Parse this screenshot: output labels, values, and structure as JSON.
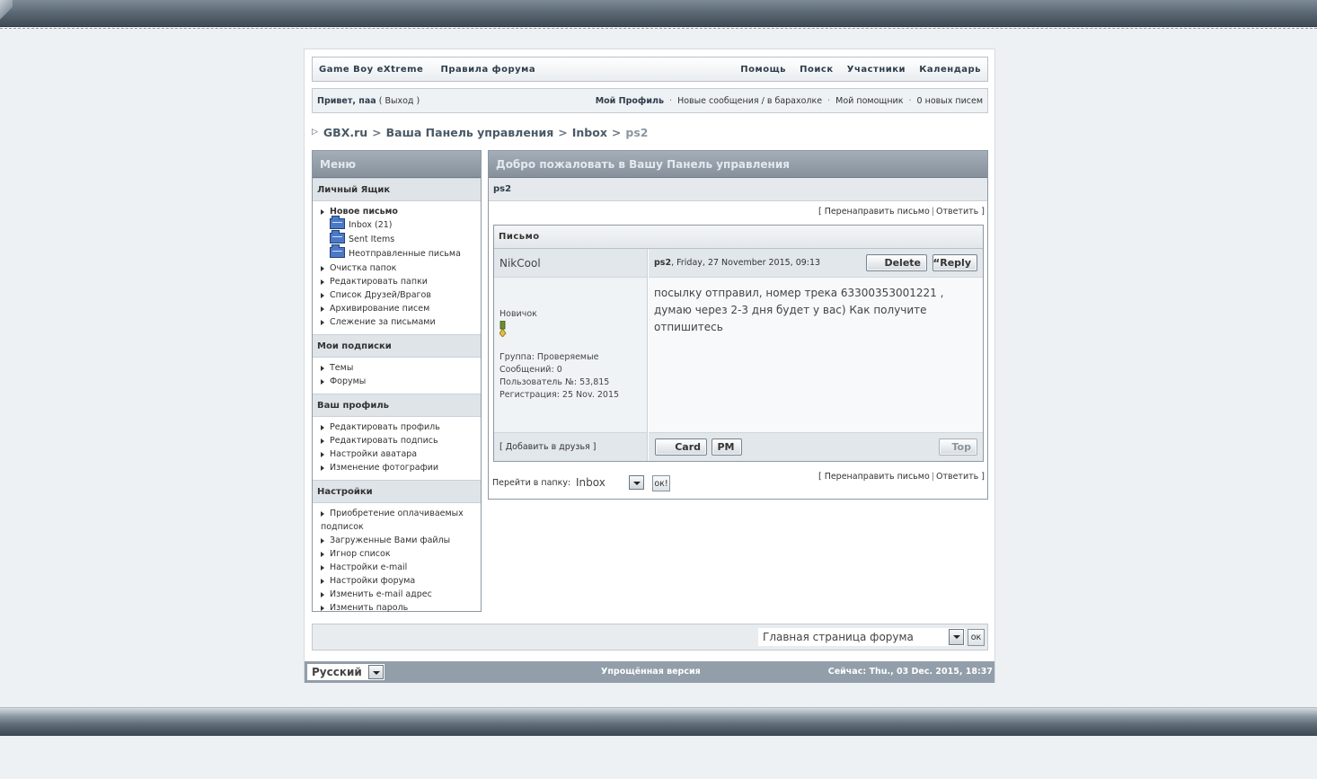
{
  "nav": {
    "left": [
      "Game Boy eXtreme",
      "Правила форума"
    ],
    "right": [
      "Помощь",
      "Поиск",
      "Участники",
      "Календарь"
    ]
  },
  "userbar": {
    "greeting_prefix": "Привет, ",
    "username": "паа",
    "logout": "( Выход )",
    "links": [
      "Мой Профиль",
      "Новые сообщения / в барахолке",
      "Мой помощник",
      "0 новых писем"
    ],
    "sep": "·"
  },
  "breadcrumb": {
    "items": [
      "GBX.ru",
      "Ваша Панель управления",
      "Inbox"
    ],
    "current": "ps2",
    "separator": ">"
  },
  "menu": {
    "title": "Меню",
    "sections": [
      {
        "title": "Личный Ящик",
        "items": [
          "Новое письмо",
          "Inbox (21)",
          "Sent Items",
          "Неотправленные письма",
          "Очистка папок",
          "Редактировать папки",
          "Список Друзей/Врагов",
          "Архивирование писем",
          "Слежение за письмами"
        ]
      },
      {
        "title": "Мои подписки",
        "items": [
          "Темы",
          "Форумы"
        ]
      },
      {
        "title": "Ваш профиль",
        "items": [
          "Редактировать профиль",
          "Редактировать подпись",
          "Настройки аватара",
          "Изменение фотографии"
        ]
      },
      {
        "title": "Настройки",
        "items": [
          "Приобретение оплачиваемых подписок",
          "Загруженные Вами файлы",
          "Игнор список",
          "Настройки e-mail",
          "Настройки форума",
          "Изменить e-mail адрес",
          "Изменить пароль"
        ]
      }
    ]
  },
  "main": {
    "title": "Добро пожаловать в Вашу Панель управления",
    "subject": "ps2",
    "forward": "Перенаправить письмо",
    "reply": "Ответить",
    "message": {
      "header": "Письмо",
      "author": "NikCool",
      "post_title": "ps2",
      "post_date": ", Friday, 27 November 2015, 09:13",
      "delete_btn": "Delete",
      "reply_btn": "Reply",
      "body": "посылку отправил, номер трека 63300353001221 , думаю через 2-3 дня будет у вас) Как получите отпишитесь",
      "rank": "Новичок",
      "group": "Группа: Проверяемые",
      "posts": "Сообщений: 0",
      "user_no": "Пользователь №: 53,815",
      "registered": "Регистрация: 25 Nov. 2015",
      "add_friend": "[ Добавить в друзья ]",
      "card_btn": "Card",
      "pm_btn": "PM",
      "top_btn": "Top"
    },
    "folder_label": "Перейти в папку:",
    "folder_value": "Inbox",
    "ok": "ок!"
  },
  "quickjump": {
    "value": "Главная страница форума",
    "ok": "ок"
  },
  "footer": {
    "language": "Русский",
    "lofi": "Упрощённая версия",
    "time": "Сейчас: Thu., 03 Dec. 2015, 18:37"
  }
}
